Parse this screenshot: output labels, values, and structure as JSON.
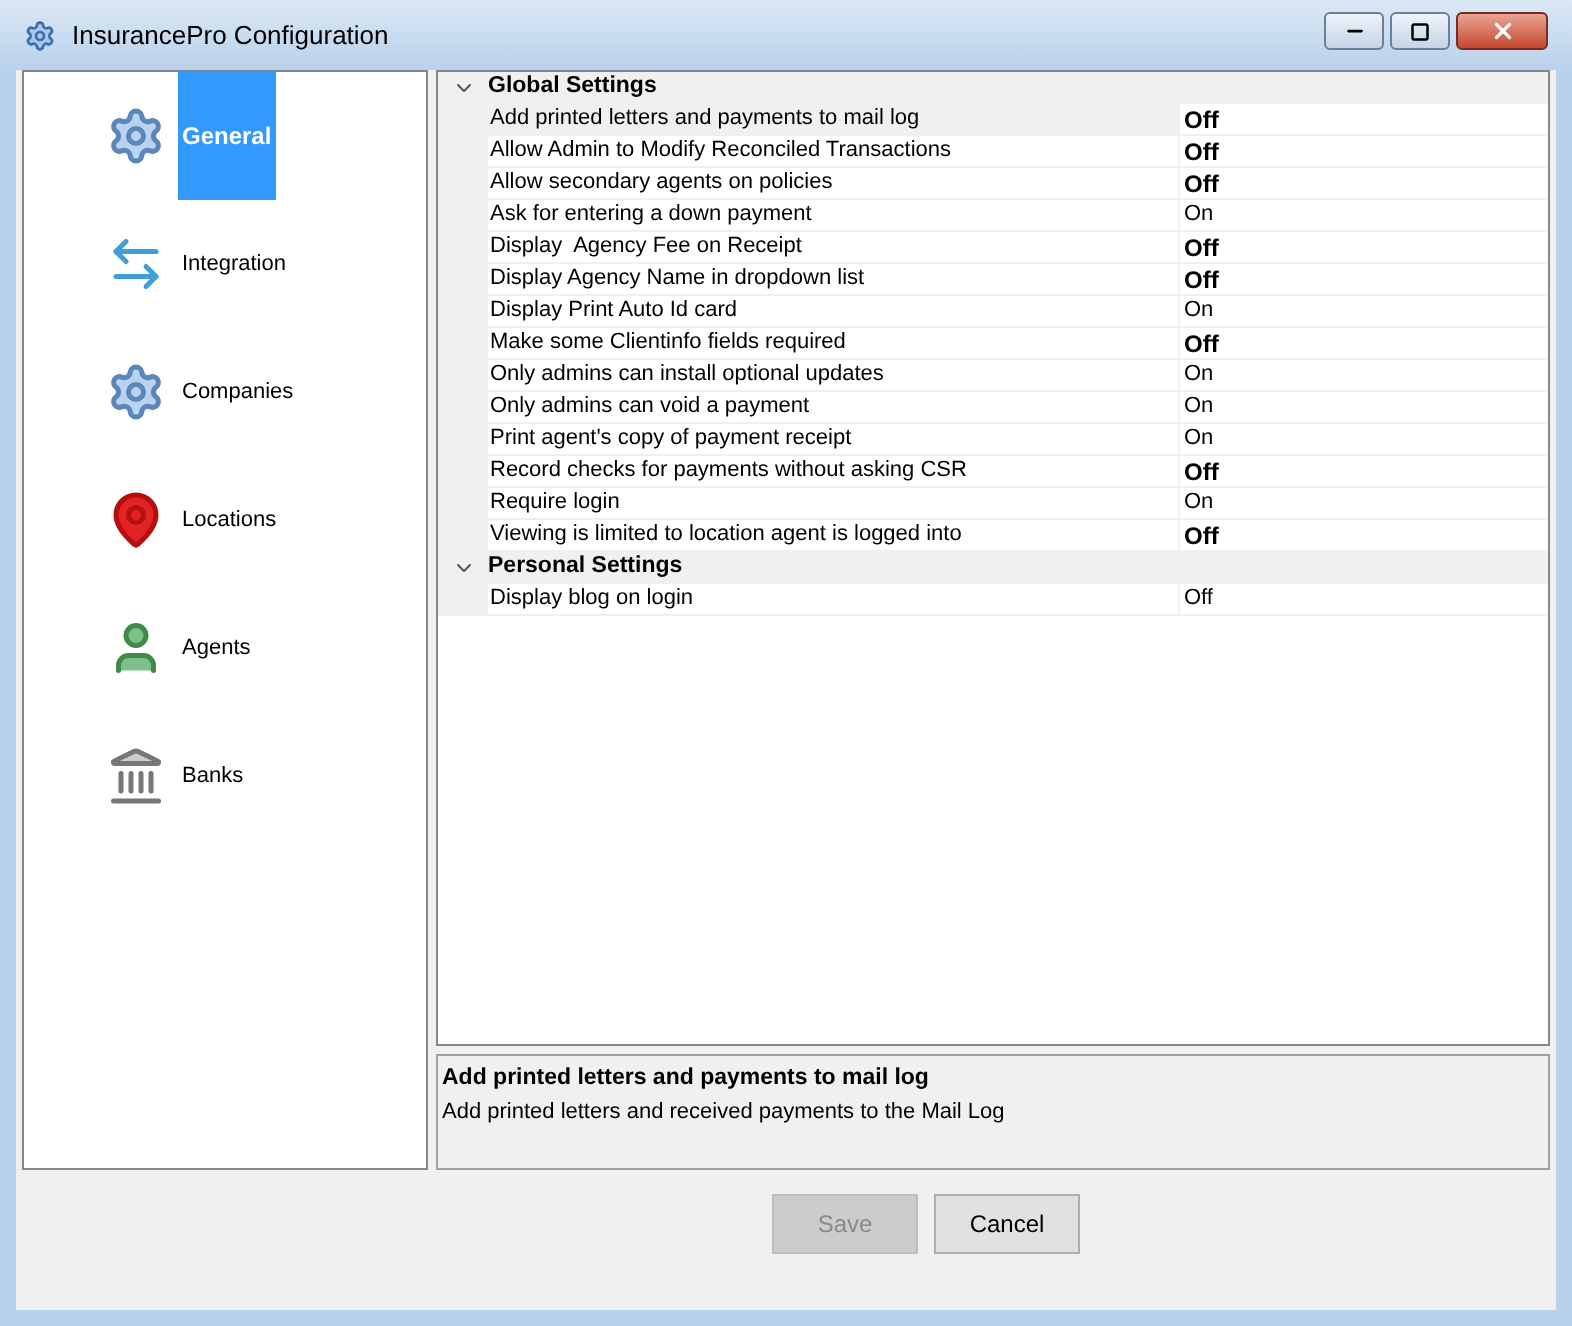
{
  "window": {
    "title": "InsurancePro Configuration"
  },
  "sidebar": {
    "items": [
      {
        "label": "General",
        "kind": "gear",
        "selected": true
      },
      {
        "label": "Integration",
        "kind": "arrows",
        "selected": false
      },
      {
        "label": "Companies",
        "kind": "gear",
        "selected": false
      },
      {
        "label": "Locations",
        "kind": "pin",
        "selected": false
      },
      {
        "label": "Agents",
        "kind": "person",
        "selected": false
      },
      {
        "label": "Banks",
        "kind": "bank",
        "selected": false
      }
    ]
  },
  "groups": [
    {
      "title": "Global Settings",
      "expanded": true,
      "rows": [
        {
          "label": "Add printed letters and payments to mail log",
          "value": "Off",
          "modified": true,
          "selected": true
        },
        {
          "label": "Allow Admin to Modify Reconciled Transactions",
          "value": "Off",
          "modified": true,
          "selected": false
        },
        {
          "label": "Allow secondary agents on policies",
          "value": "Off",
          "modified": true,
          "selected": false
        },
        {
          "label": "Ask for entering a down payment",
          "value": "On",
          "modified": false,
          "selected": false
        },
        {
          "label": "Display  Agency Fee on Receipt",
          "value": "Off",
          "modified": true,
          "selected": false
        },
        {
          "label": "Display Agency Name in dropdown list",
          "value": "Off",
          "modified": true,
          "selected": false
        },
        {
          "label": "Display Print Auto Id card",
          "value": "On",
          "modified": false,
          "selected": false
        },
        {
          "label": "Make some Clientinfo fields required",
          "value": "Off",
          "modified": true,
          "selected": false
        },
        {
          "label": "Only admins can install optional updates",
          "value": "On",
          "modified": false,
          "selected": false
        },
        {
          "label": "Only admins can void a payment",
          "value": "On",
          "modified": false,
          "selected": false
        },
        {
          "label": "Print agent's copy of payment receipt",
          "value": "On",
          "modified": false,
          "selected": false
        },
        {
          "label": "Record checks for payments without asking CSR",
          "value": "Off",
          "modified": true,
          "selected": false
        },
        {
          "label": "Require login",
          "value": "On",
          "modified": false,
          "selected": false
        },
        {
          "label": "Viewing is limited to location agent is logged into",
          "value": "Off",
          "modified": true,
          "selected": false
        }
      ]
    },
    {
      "title": "Personal Settings",
      "expanded": true,
      "rows": [
        {
          "label": "Display blog on login",
          "value": "Off",
          "modified": false,
          "selected": false
        }
      ]
    }
  ],
  "description": {
    "title": "Add printed letters and payments to mail log",
    "text": "Add printed letters and received payments to the Mail Log"
  },
  "buttons": [
    {
      "label": "Save",
      "disabled": true
    },
    {
      "label": "Cancel",
      "disabled": false
    }
  ]
}
